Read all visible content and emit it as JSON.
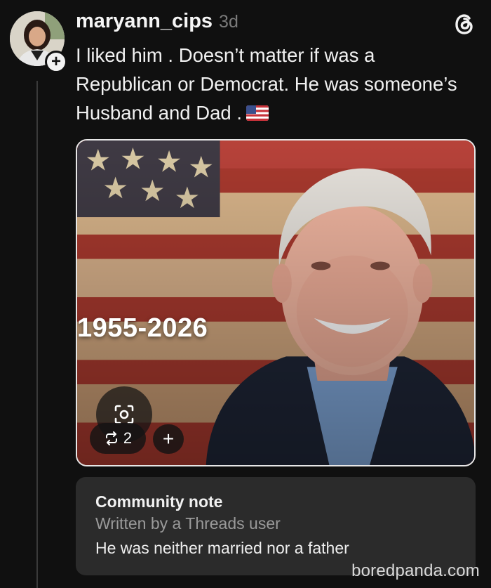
{
  "post": {
    "username": "maryann_cips",
    "timestamp": "3d",
    "text": "I liked him . Doesn’t matter if was a Republican or Democrat. He was someone’s Husband and Dad .",
    "emoji": "us-flag-emoji",
    "follow_icon": "plus-icon"
  },
  "media": {
    "years_label": "1955-2026",
    "repost_count": "2",
    "repost_icon": "repost-icon",
    "lens_icon": "visual-search-icon",
    "add_icon": "plus-icon"
  },
  "community_note": {
    "title": "Community note",
    "author": "Written by a Threads user",
    "body": "He was neither married nor a father"
  },
  "app": {
    "logo": "threads-logo-icon"
  },
  "watermark": "boredpanda.com",
  "colors": {
    "background": "#101010",
    "note_card": "#2b2b2b",
    "muted_text": "#7b7b7b"
  }
}
